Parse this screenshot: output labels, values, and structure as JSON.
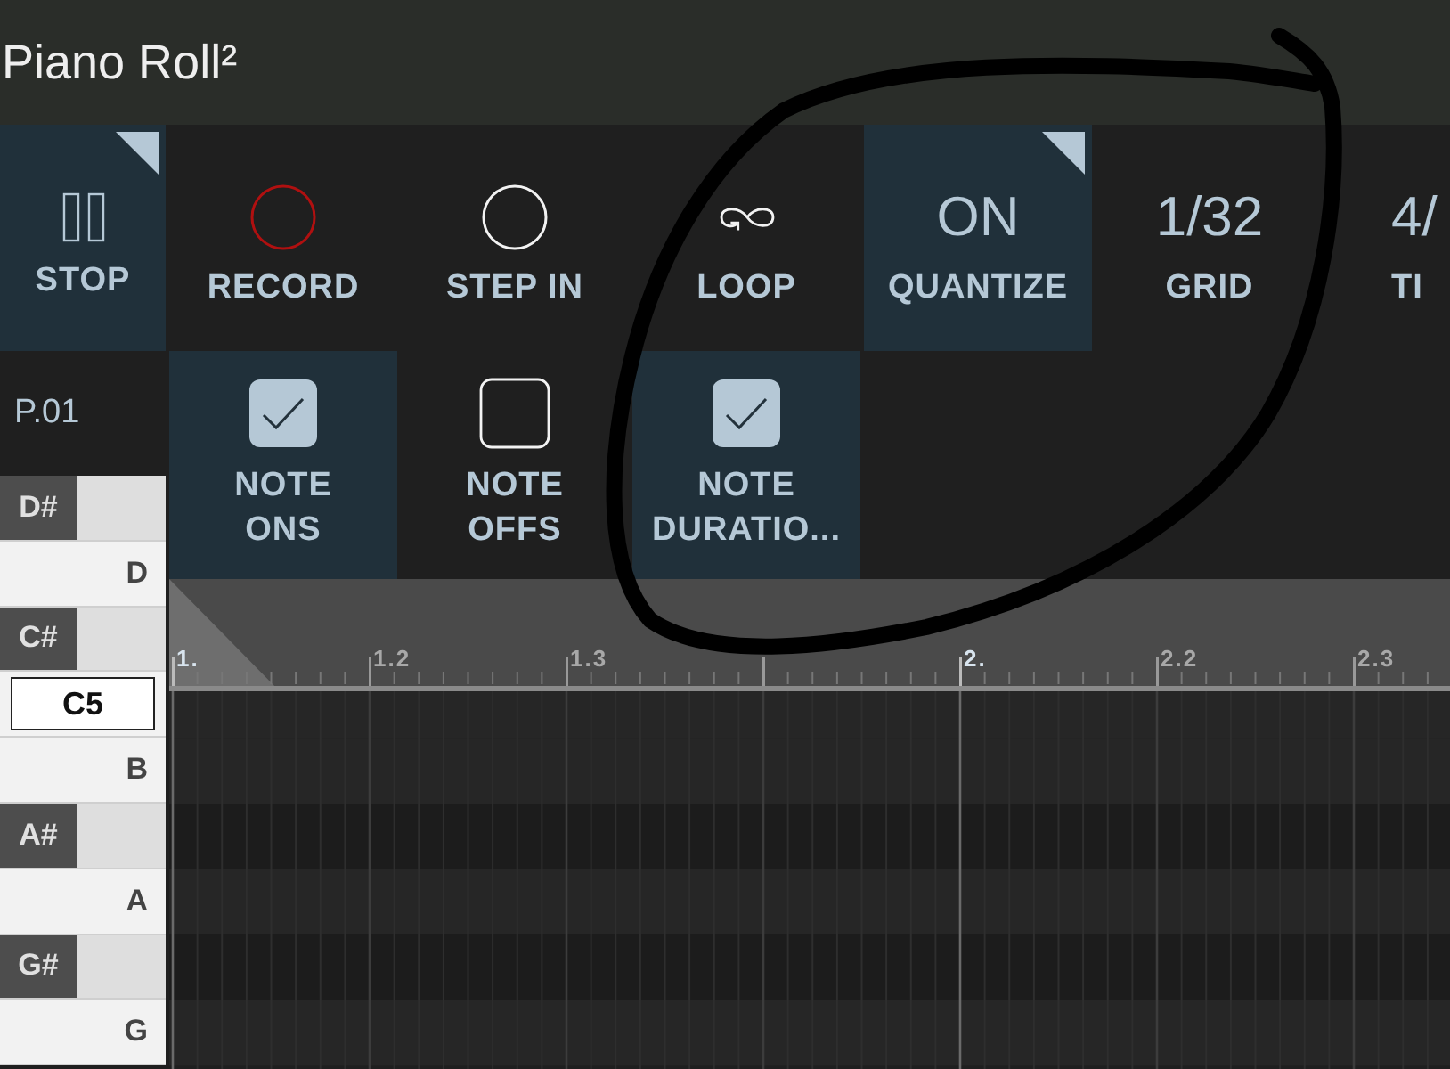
{
  "window": {
    "title": "Piano Roll²"
  },
  "transport": [
    {
      "kind": "pause",
      "label": "STOP",
      "active": true,
      "corner_mark": true
    },
    {
      "kind": "record",
      "label": "RECORD",
      "active": false,
      "corner_mark": false
    },
    {
      "kind": "step",
      "label": "STEP IN",
      "active": false,
      "corner_mark": false
    },
    {
      "kind": "loop",
      "label": "LOOP",
      "active": false,
      "corner_mark": false
    },
    {
      "kind": "value",
      "value": "ON",
      "label": "QUANTIZE",
      "active": true,
      "corner_mark": true
    },
    {
      "kind": "value",
      "value": "1/32",
      "label": "GRID",
      "active": false,
      "corner_mark": false
    },
    {
      "kind": "value",
      "value": "4/",
      "label": "TI",
      "active": false,
      "corner_mark": false
    }
  ],
  "pattern": {
    "name": "P.01"
  },
  "filters": [
    {
      "label": "NOTE\nONS",
      "checked": true
    },
    {
      "label": "NOTE\nOFFS",
      "checked": false
    },
    {
      "label": "NOTE\nDURATIO...",
      "checked": true
    }
  ],
  "keys": [
    {
      "kind": "black",
      "label": "D#",
      "selected": false
    },
    {
      "kind": "white",
      "label": "D",
      "selected": false
    },
    {
      "kind": "black",
      "label": "C#",
      "selected": false
    },
    {
      "kind": "white",
      "label": "C5",
      "selected": true
    },
    {
      "kind": "white",
      "label": "B",
      "selected": false
    },
    {
      "kind": "black",
      "label": "A#",
      "selected": false
    },
    {
      "kind": "white",
      "label": "A",
      "selected": false
    },
    {
      "kind": "black",
      "label": "G#",
      "selected": false
    },
    {
      "kind": "white",
      "label": "G",
      "selected": false
    }
  ],
  "ruler": [
    {
      "label": "1.",
      "bar_start": true
    },
    {
      "label": "1.2",
      "bar_start": false
    },
    {
      "label": "1.3",
      "bar_start": false
    },
    {
      "bar_start": false
    },
    {
      "label": "2.",
      "bar_start": true
    },
    {
      "label": "2.2",
      "bar_start": false
    },
    {
      "label": "2.3",
      "bar_start": false
    }
  ]
}
